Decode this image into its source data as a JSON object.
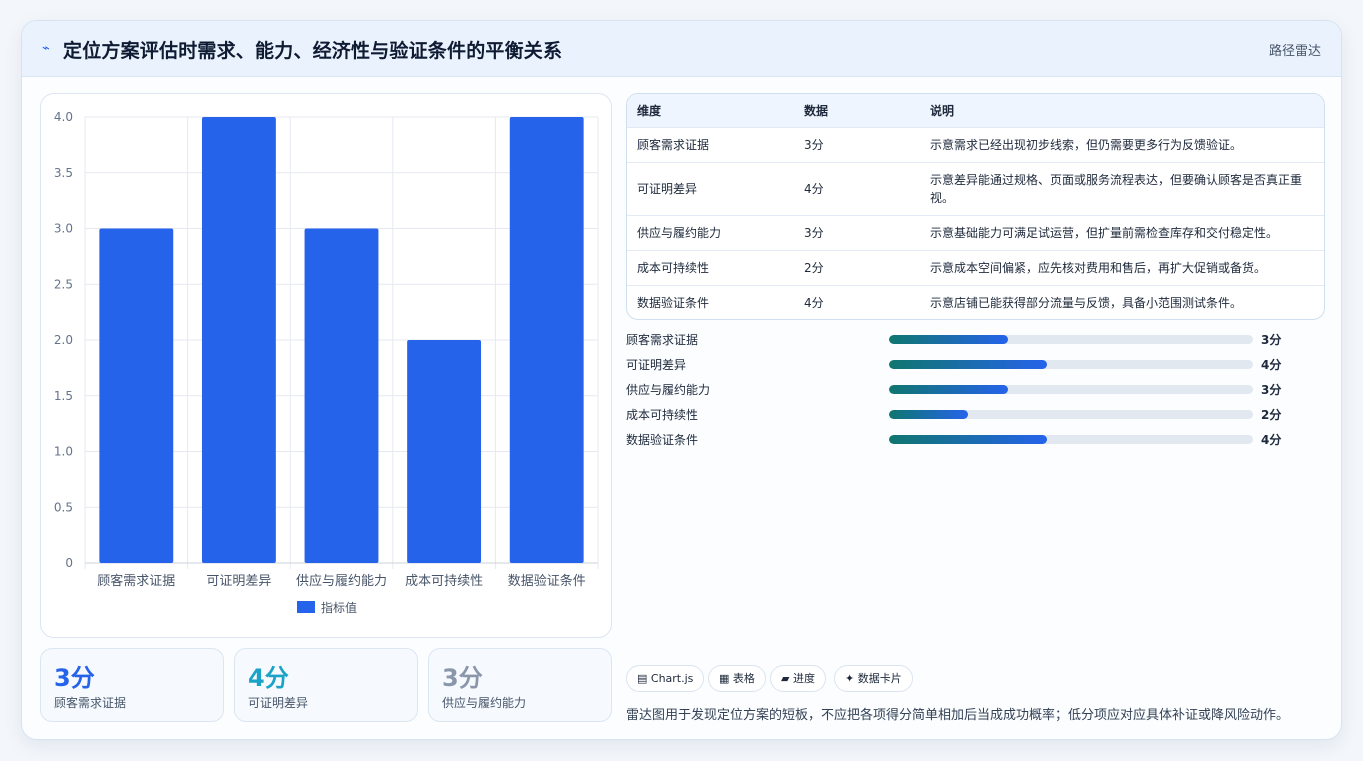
{
  "header": {
    "logo_glyph": "⌁",
    "title": "定位方案评估时需求、能力、经济性与验证条件的平衡关系",
    "tag": "路径雷达"
  },
  "chart_data": {
    "type": "bar",
    "categories": [
      "顾客需求证据",
      "可证明差异",
      "供应与履约能力",
      "成本可持续性",
      "数据验证条件"
    ],
    "series": [
      {
        "name": "指标值",
        "values": [
          3,
          4,
          3,
          2,
          4
        ]
      }
    ],
    "y_ticks": [
      "0",
      "0.5",
      "1.0",
      "1.5",
      "2.0",
      "2.5",
      "3.0",
      "3.5",
      "4.0"
    ],
    "ylim": [
      0,
      4
    ],
    "grid": true,
    "legend": "bottom",
    "color": "#2563eb"
  },
  "stats": [
    {
      "value": "3分",
      "label": "顾客需求证据",
      "color": "#2563eb"
    },
    {
      "value": "4分",
      "label": "可证明差异",
      "color": "#1aa3c6"
    },
    {
      "value": "3分",
      "label": "供应与履约能力",
      "color": "#8a97ab"
    }
  ],
  "table": {
    "headers": [
      "维度",
      "数据",
      "说明"
    ],
    "rows": [
      {
        "dim": "顾客需求证据",
        "score": "3分",
        "desc": "示意需求已经出现初步线索，但仍需要更多行为反馈验证。"
      },
      {
        "dim": "可证明差异",
        "score": "4分",
        "desc": "示意差异能通过规格、页面或服务流程表达，但要确认顾客是否真正重视。"
      },
      {
        "dim": "供应与履约能力",
        "score": "3分",
        "desc": "示意基础能力可满足试运营，但扩量前需检查库存和交付稳定性。"
      },
      {
        "dim": "成本可持续性",
        "score": "2分",
        "desc": "示意成本空间偏紧，应先核对费用和售后，再扩大促销或备货。"
      },
      {
        "dim": "数据验证条件",
        "score": "4分",
        "desc": "示意店铺已能获得部分流量与反馈，具备小范围测试条件。"
      }
    ]
  },
  "progress": [
    {
      "label": "顾客需求证据",
      "value": 3,
      "max": 9.2,
      "text": "3分"
    },
    {
      "label": "可证明差异",
      "value": 4,
      "max": 9.2,
      "text": "4分"
    },
    {
      "label": "供应与履约能力",
      "value": 3,
      "max": 9.2,
      "text": "3分"
    },
    {
      "label": "成本可持续性",
      "value": 2,
      "max": 9.2,
      "text": "2分"
    },
    {
      "label": "数据验证条件",
      "value": 4,
      "max": 9.2,
      "text": "4分"
    }
  ],
  "chips": [
    "▤ Chart.js",
    "▦ 表格",
    "▰ 进度",
    "✦ 数据卡片"
  ],
  "note": "雷达图用于发现定位方案的短板，不应把各项得分简单相加后当成成功概率；低分项应对应具体补证或降风险动作。"
}
